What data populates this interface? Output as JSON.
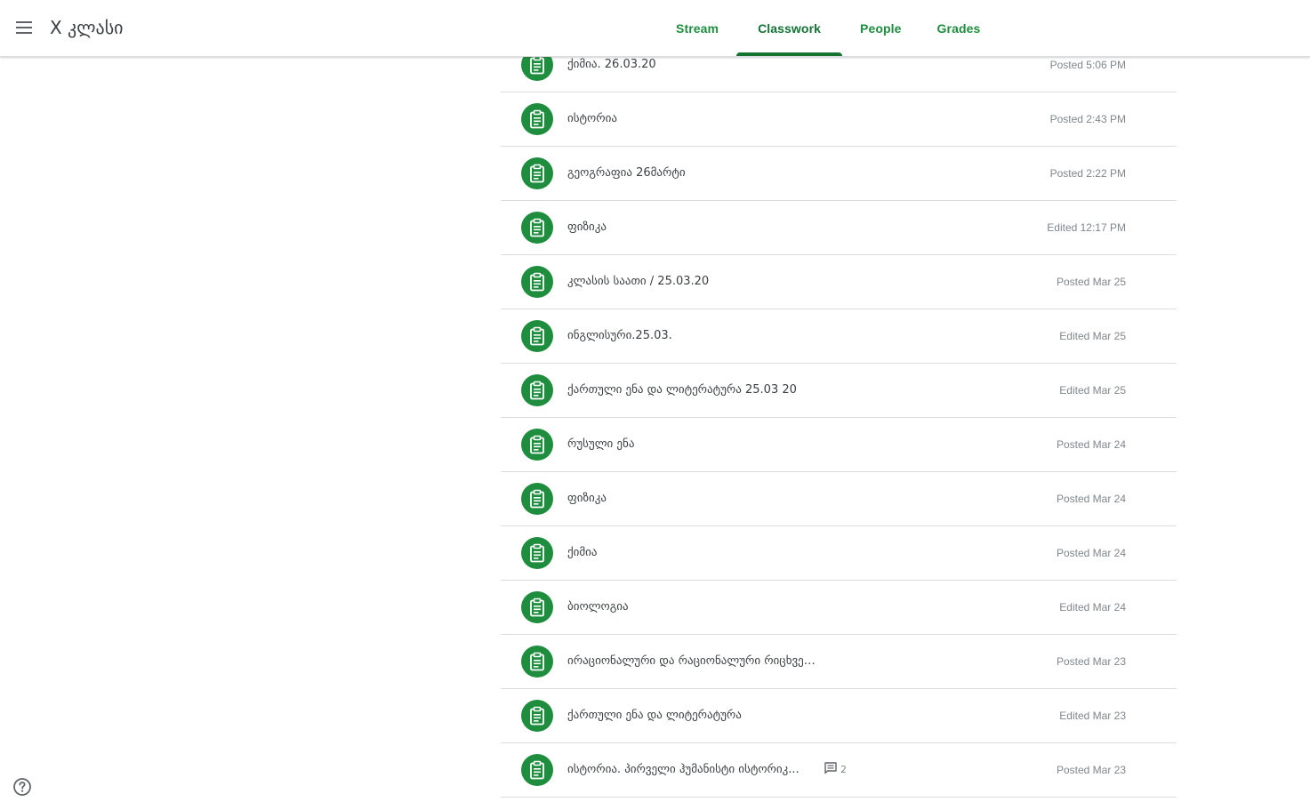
{
  "header": {
    "menu_icon": "hamburger-menu-icon",
    "class_title": "X კლასი",
    "tabs": [
      {
        "label": "Stream",
        "active": false
      },
      {
        "label": "Classwork",
        "active": true
      },
      {
        "label": "People",
        "active": false
      },
      {
        "label": "Grades",
        "active": false
      }
    ]
  },
  "colors": {
    "accent": "#1e8e3e",
    "accent_dark": "#137333",
    "muted_text": "#80868b",
    "divider": "#dadce0"
  },
  "assignments": [
    {
      "title": "ქიმია. 26.03.20",
      "status": "Posted 5:06 PM",
      "icon": "assignment-icon"
    },
    {
      "title": "ისტორია",
      "status": "Posted 2:43 PM",
      "icon": "assignment-icon"
    },
    {
      "title": "გეოგრაფია 26მარტი",
      "status": "Posted 2:22 PM",
      "icon": "assignment-icon"
    },
    {
      "title": "ფიზიკა",
      "status": "Edited 12:17 PM",
      "icon": "assignment-icon"
    },
    {
      "title": "კლასის საათი / 25.03.20",
      "status": "Posted Mar 25",
      "icon": "assignment-icon"
    },
    {
      "title": "ინგლისური.25.03.",
      "status": "Edited Mar 25",
      "icon": "assignment-icon"
    },
    {
      "title": "ქართული ენა და ლიტერატურა 25.03 20",
      "status": "Edited Mar 25",
      "icon": "assignment-icon"
    },
    {
      "title": "რუსული ენა",
      "status": "Posted Mar 24",
      "icon": "assignment-icon"
    },
    {
      "title": "ფიზიკა",
      "status": "Posted Mar 24",
      "icon": "assignment-icon"
    },
    {
      "title": "ქიმია",
      "status": "Posted Mar 24",
      "icon": "assignment-icon"
    },
    {
      "title": "ბიოლოგია",
      "status": "Edited Mar 24",
      "icon": "assignment-icon"
    },
    {
      "title": "ირაციონალური და რაციონალური რიცხვები:",
      "status": "Posted Mar 23",
      "icon": "assignment-icon"
    },
    {
      "title": "ქართული ენა და ლიტერატურა",
      "status": "Edited Mar 23",
      "icon": "assignment-icon"
    },
    {
      "title": "ისტორია. პირველი ჰუმანისტი ისტორიკ...",
      "status": "Posted Mar 23",
      "icon": "assignment-icon",
      "comment_count": "2"
    }
  ],
  "footer": {
    "help_icon": "help-circle-icon"
  }
}
